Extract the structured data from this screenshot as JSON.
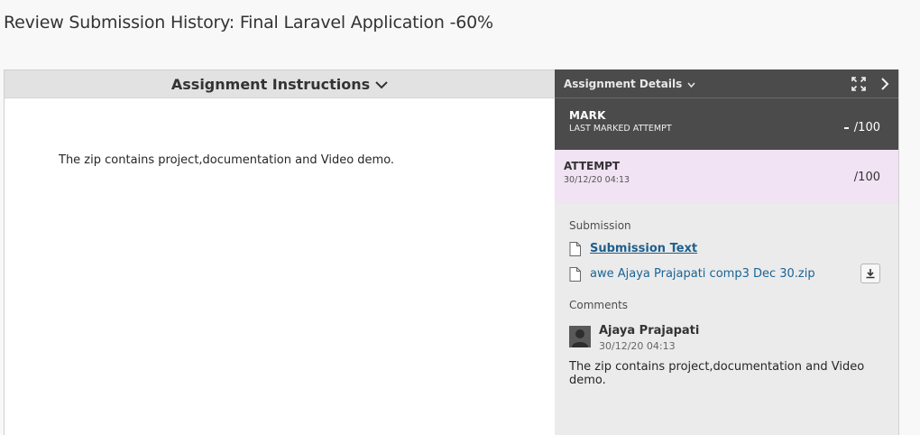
{
  "page": {
    "title": "Review Submission History: Final Laravel Application -60%"
  },
  "instructions": {
    "header_label": "Assignment Instructions",
    "body_text": "The zip contains project,documentation and Video demo."
  },
  "details": {
    "header_label": "Assignment Details",
    "mark": {
      "label": "MARK",
      "sub_label": "LAST MARKED ATTEMPT",
      "value": "/100"
    },
    "attempt": {
      "label": "ATTEMPT",
      "date": "30/12/20 04:13",
      "value": "/100"
    },
    "submission": {
      "section_label": "Submission",
      "files": [
        {
          "name": "Submission Text",
          "icon": "document-icon"
        },
        {
          "name": "awe Ajaya Prajapati comp3 Dec 30.zip",
          "icon": "document-icon"
        }
      ]
    },
    "comments": {
      "section_label": "Comments",
      "items": [
        {
          "author": "Ajaya Prajapati",
          "date": "30/12/20 04:13",
          "text": "The zip contains project,documentation and Video demo."
        }
      ]
    }
  },
  "colors": {
    "details_header_bg": "#4b4b4b",
    "attempt_bg": "#f1e2f4",
    "link": "#1a6496"
  }
}
